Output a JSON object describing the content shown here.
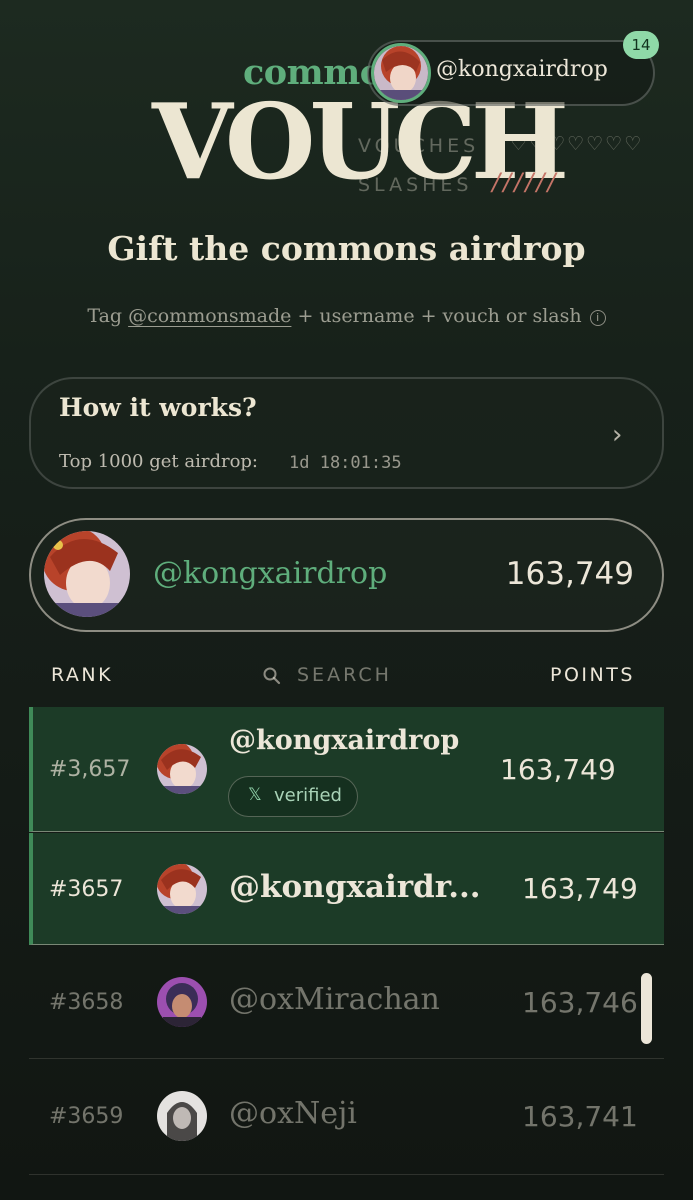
{
  "header": {
    "logo_commons": "commons",
    "logo_vouch": "VOUCH",
    "vouches_label": "VOUCHES",
    "slashes_label": "SLASHES",
    "hearts": "♡♡♡♡♡♡♡",
    "slash_marks": "//////",
    "profile_handle": "@kongxairdrop",
    "notification_count": "14"
  },
  "hero": {
    "title": "Gift the commons airdrop",
    "sub_prefix": "Tag ",
    "sub_handle": "@commonsmade",
    "sub_suffix": " + username + vouch or slash"
  },
  "how_it_works": {
    "title": "How it works?",
    "subtitle": "Top 1000 get airdrop:",
    "countdown": "1d 18:01:35"
  },
  "my_score": {
    "handle": "@kongxairdrop",
    "points": "163,749"
  },
  "table": {
    "rank_header": "RANK",
    "search_placeholder": "SEARCH",
    "points_header": "POINTS",
    "rows": [
      {
        "rank": "#3,657",
        "handle": "@kongxairdrop",
        "points": "163,749",
        "badge": "verified",
        "badge_icon": "x-logo-icon"
      },
      {
        "rank": "#3657",
        "handle": "@kongxairdr...",
        "points": "163,749"
      },
      {
        "rank": "#3658",
        "handle": "@oxMirachan",
        "points": "163,746"
      },
      {
        "rank": "#3659",
        "handle": "@oxNeji",
        "points": "163,741"
      }
    ]
  },
  "colors": {
    "background": "#151c17",
    "accent_green": "#5fae7c",
    "highlight_row": "#1c3b27",
    "cream": "#ece6d2",
    "slash_red": "#c47467",
    "badge_green": "#8fd9a8"
  }
}
